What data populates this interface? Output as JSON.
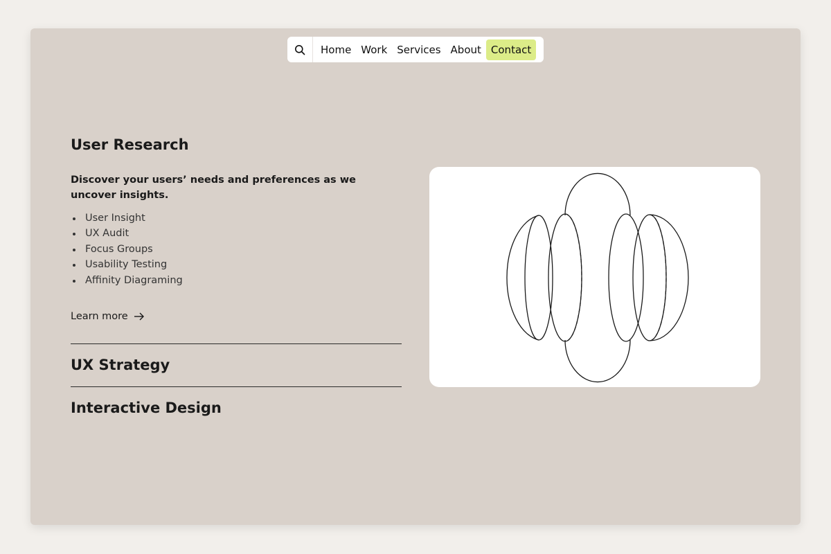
{
  "nav": {
    "search_icon": "search-icon",
    "items": [
      "Home",
      "Work",
      "Services",
      "About",
      "Contact"
    ],
    "active": "Contact",
    "active_color": "#dcec88"
  },
  "services": {
    "active": {
      "title": "User Research",
      "lead": "Discover your users’ needs and preferences as we uncover insights.",
      "bullets": [
        "User Insight",
        "UX Audit",
        "Focus Groups",
        "Usability Testing",
        "Affinity Diagraming"
      ],
      "learn_more": "Learn more",
      "learn_more_icon": "arrow-right-icon"
    },
    "others": [
      "UX Strategy",
      "Interactive Design"
    ]
  },
  "illustration": {
    "icon": "sliced-sphere-illustration"
  },
  "colors": {
    "page_bg": "#f2efeb",
    "panel_bg": "#d9d1ca",
    "card_bg": "#ffffff"
  }
}
